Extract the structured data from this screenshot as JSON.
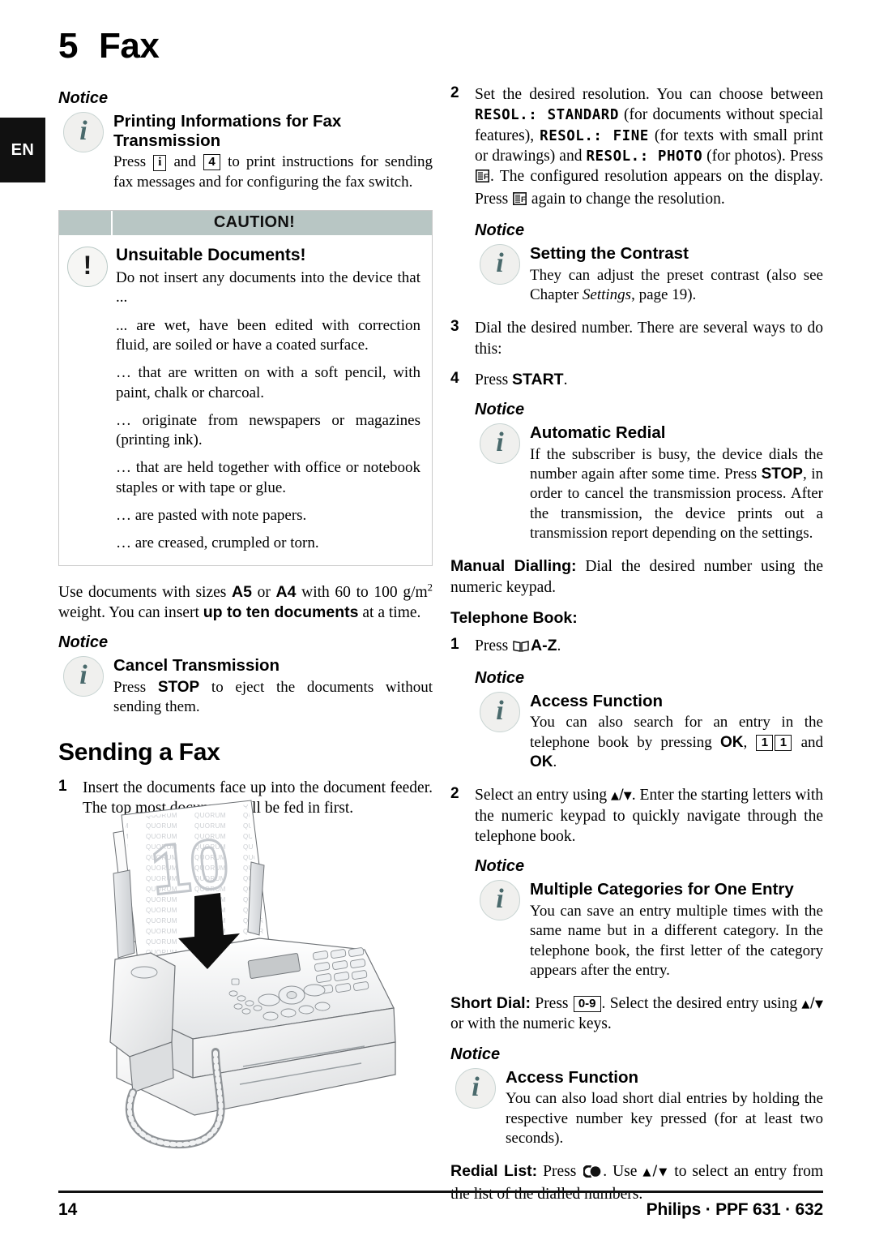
{
  "page": {
    "language_tab": "EN",
    "chapter_number": "5",
    "chapter_title": "Fax",
    "footer_page_number": "14",
    "footer_product": "Philips · PPF 631 · 632",
    "accent_caution_bg": "#b8c6c4",
    "accent_icon_text": "#4a6a6c"
  },
  "left_column": {
    "notice_label": "Notice",
    "notice_printing": {
      "icon": "info-icon",
      "heading": "Printing Informations for Fax Transmission",
      "body_before_key1": "Press ",
      "key1": "i",
      "body_between_keys": " and ",
      "key2": "4",
      "body_after_keys": " to print instructions for sending fax messages and for configuring the fax switch."
    },
    "caution": {
      "header_label": "CAUTION!",
      "icon": "warning-icon",
      "title": "Unsuitable Documents!",
      "paragraphs": [
        "Do not insert any documents into the device that ...",
        "... are wet, have been edited with correction fluid, are soiled or have a coated surface.",
        "… that are written on with a soft pencil, with paint, chalk or charcoal.",
        "… originate from newspapers or magazines (printing ink).",
        "… that are held together with office or notebook staples or with tape or glue.",
        "… are pasted with note papers.",
        "… are creased, crumpled or torn."
      ]
    },
    "doc_sizes_paragraph": {
      "p1": "Use documents with sizes ",
      "b1": "A5",
      "p2": " or ",
      "b2": "A4",
      "p3": " with 60 to 100 g/m",
      "sup": "2",
      "p4": " weight. You can insert ",
      "b3": "up to ten documents",
      "p5": " at a time."
    },
    "notice_cancel": {
      "label": "Notice",
      "icon": "info-icon",
      "heading": "Cancel Transmission",
      "body_before": "Press ",
      "bold_key": "STOP",
      "body_after": " to eject the documents without sending them."
    },
    "section_heading": "Sending a Fax",
    "step_1": {
      "number": "1",
      "text": "Insert the documents face up into the document feeder. The top most document will be fed in first."
    },
    "illustration": {
      "name": "fax-machine-illustration",
      "watermark_number": "10",
      "paper_text_pattern": "QUORUM"
    }
  },
  "right_column": {
    "step_2": {
      "number": "2",
      "t1": "Set the desired resolution. You can choose between ",
      "mono1": "RESOL.: STANDARD",
      "t2": " (for documents without special features), ",
      "mono2": "RESOL.: FINE",
      "t3": " (for texts with small print or drawings) and ",
      "mono3": "RESOL.: PHOTO",
      "t4": " (for photos). Press ",
      "icon1": "resolution-key-icon",
      "t5": ". The configured resolution appears on the display. Press ",
      "icon2": "resolution-key-icon",
      "t6": " again to change the resolution."
    },
    "notice_contrast": {
      "label": "Notice",
      "icon": "info-icon",
      "heading": "Setting the Contrast",
      "body_p1": "They can adjust the preset contrast (also see Chapter ",
      "body_italic": "Settings",
      "body_p2": ", page 19)."
    },
    "step_3": {
      "number": "3",
      "text": "Dial the desired number. There are several ways to do this:"
    },
    "step_4": {
      "number": "4",
      "t1": "Press ",
      "bold_key": "START",
      "t2": "."
    },
    "notice_redial": {
      "label": "Notice",
      "icon": "info-icon",
      "heading": "Automatic Redial",
      "b1": "If the subscriber is busy, the device dials the number again after some time. Press ",
      "bold_key": "STOP",
      "b2": ", in order to cancel the transmission process. After the transmission, the device prints out a transmission report depending on the settings."
    },
    "manual_dialling": {
      "label": "Manual Dialling:",
      "text": " Dial the desired number using the numeric keypad."
    },
    "telephone_book_label": "Telephone Book:",
    "tb_step_1": {
      "number": "1",
      "t1": "Press ",
      "icon": "open-book-icon",
      "bold_key": "A-Z",
      "t2": "."
    },
    "notice_access_1": {
      "label": "Notice",
      "icon": "info-icon",
      "heading": "Access Function",
      "b1": "You can also search for an entry in the telephone book by pressing ",
      "bold_ok1": "OK",
      "b2": ", ",
      "key1": "1",
      "key2": "1",
      "b3": " and ",
      "bold_ok2": "OK",
      "b4": "."
    },
    "tb_step_2": {
      "number": "2",
      "t1": "Select an entry using ",
      "arrows": "▲/▼",
      "t2": ". Enter the starting letters with the numeric keypad to quickly navigate through the telephone book."
    },
    "notice_categories": {
      "label": "Notice",
      "icon": "info-icon",
      "heading": "Multiple Categories for One Entry",
      "body": "You can save an entry multiple times with the same name but in a different category. In the telephone book, the first letter of the category appears after the entry."
    },
    "short_dial": {
      "label": "Short Dial:",
      "t1": " Press ",
      "key": "0-9",
      "t2": ". Select the desired entry using ",
      "arrows": "▲/▼",
      "t3": " or with the numeric keys."
    },
    "notice_access_2": {
      "label": "Notice",
      "icon": "info-icon",
      "heading": "Access Function",
      "body": "You can also load short dial entries by holding the respective number key pressed (for at least two seconds)."
    },
    "redial_list": {
      "label": "Redial List:",
      "t1": " Press ",
      "icon": "redial-key-icon",
      "t2": ". Use ",
      "arrows": "▲/▼",
      "t3": " to select an entry from the list of the dialled numbers."
    }
  }
}
